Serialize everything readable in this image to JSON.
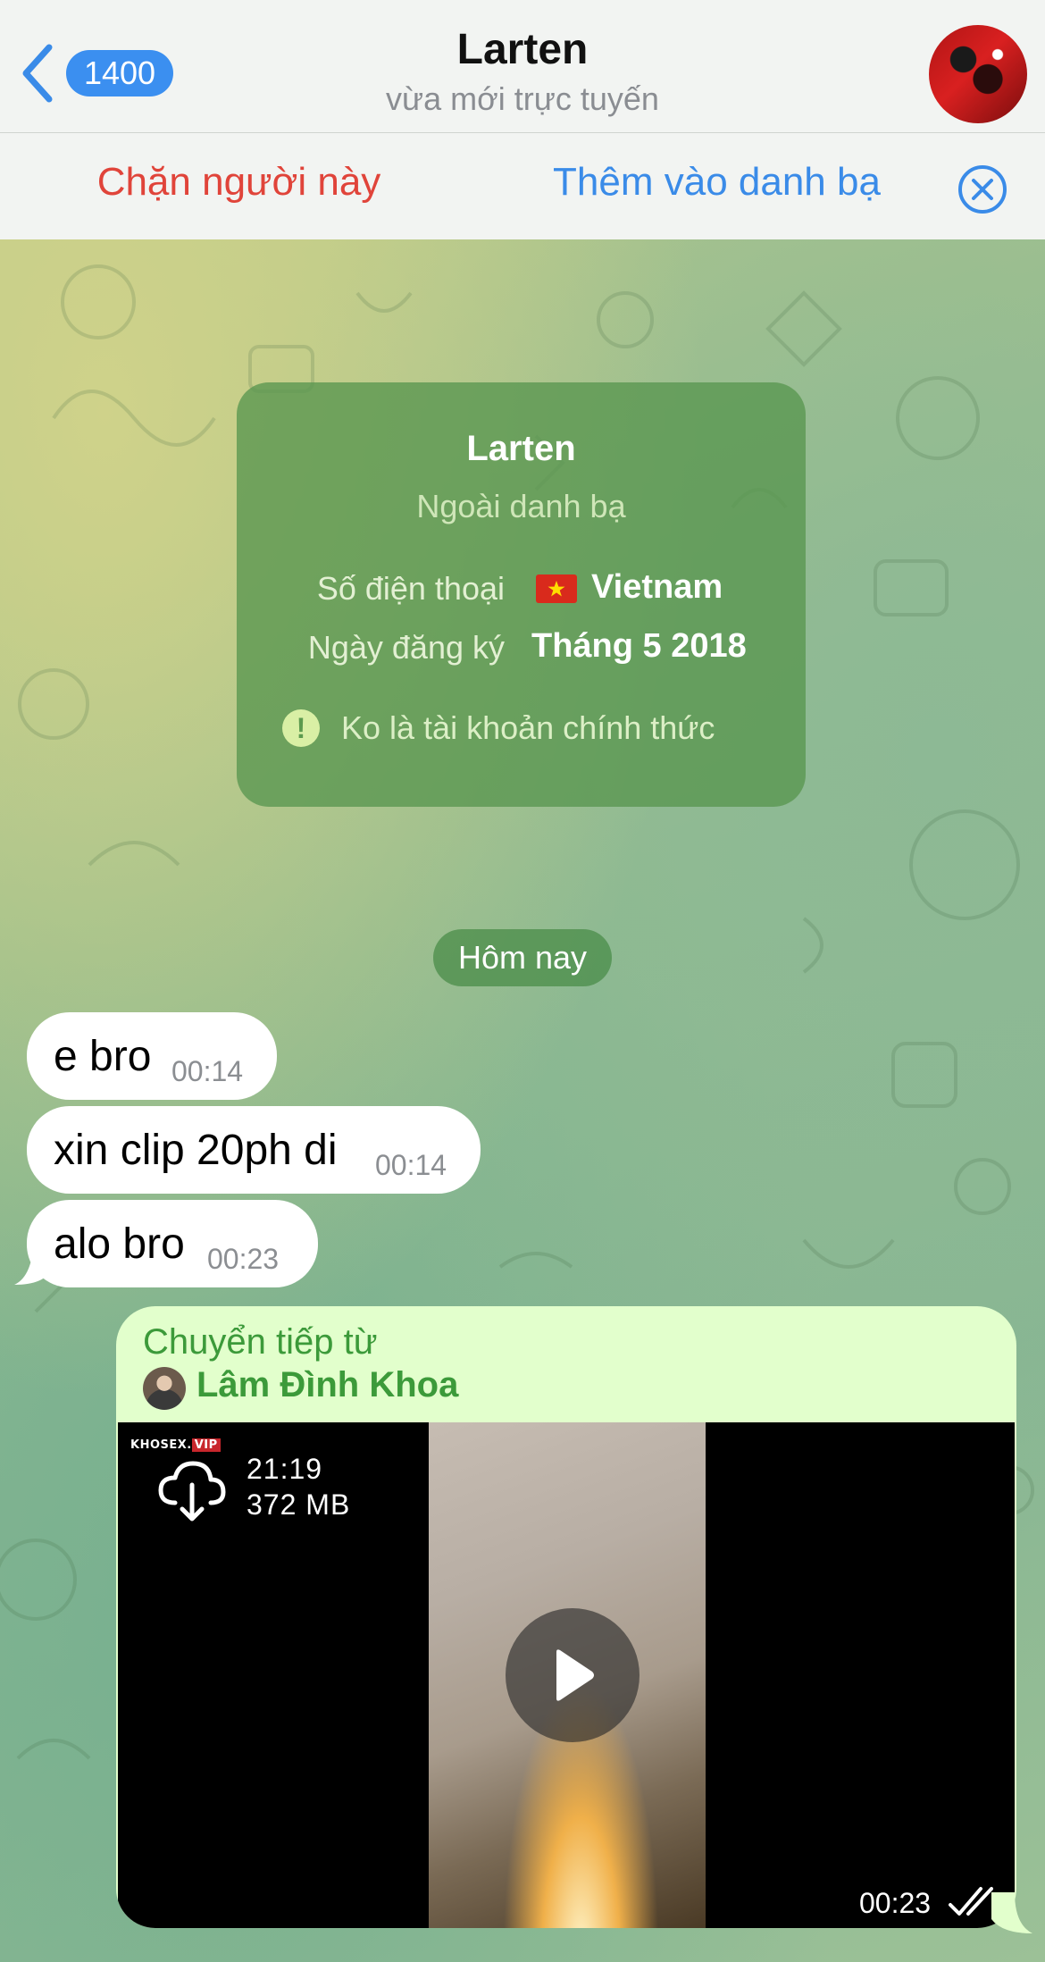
{
  "header": {
    "back_count": "1400",
    "title": "Larten",
    "status": "vừa mới trực tuyến"
  },
  "actions": {
    "block": "Chặn người này",
    "add_contact": "Thêm vào danh bạ"
  },
  "info_card": {
    "name": "Larten",
    "status": "Ngoài danh bạ",
    "phone_label": "Số điện thoại",
    "phone_value": "Vietnam",
    "reg_label": "Ngày đăng ký",
    "reg_value": "Tháng 5 2018",
    "warning": "Ko là tài khoản chính thức"
  },
  "date_separator": "Hôm nay",
  "messages": [
    {
      "text": "e bro",
      "time": "00:14"
    },
    {
      "text": "xin clip 20ph di",
      "time": "00:14"
    },
    {
      "text": "alo bro",
      "time": "00:23"
    }
  ],
  "forwarded": {
    "label": "Chuyển tiếp từ",
    "name": "Lâm Đình Khoa",
    "watermark_main": "KHOSEX.",
    "watermark_tag": "VIP",
    "video_duration": "21:19",
    "video_size": "372 MB",
    "time": "00:23"
  },
  "icons": {
    "back": "chevron-left-icon",
    "close": "close-circle-icon",
    "download": "cloud-download-icon",
    "play": "play-icon",
    "read": "double-check-icon",
    "warning": "exclamation-icon",
    "flag": "vietnam-flag-icon"
  },
  "colors": {
    "accent_blue": "#3a8be8",
    "danger_red": "#e0443a",
    "card_green": "#5a9650",
    "outgoing_bubble": "#e2ffcc",
    "forward_green": "#3c9a3a"
  }
}
